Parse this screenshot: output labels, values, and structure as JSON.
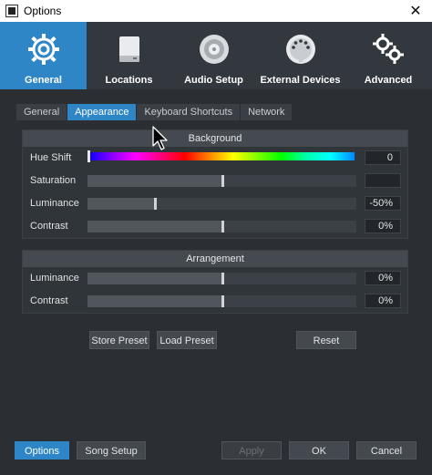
{
  "window": {
    "title": "Options",
    "close_glyph": "✕"
  },
  "topnav": [
    {
      "label": "General",
      "icon": "gear-icon",
      "active": true
    },
    {
      "label": "Locations",
      "icon": "drive-icon",
      "active": false
    },
    {
      "label": "Audio Setup",
      "icon": "speaker-icon",
      "active": false
    },
    {
      "label": "External Devices",
      "icon": "midi-port-icon",
      "active": false
    },
    {
      "label": "Advanced",
      "icon": "gears-icon",
      "active": false
    }
  ],
  "subtabs": [
    "General",
    "Appearance",
    "Keyboard Shortcuts",
    "Network"
  ],
  "background": {
    "header": "Background",
    "hue_shift": {
      "label": "Hue Shift",
      "value": "0"
    },
    "saturation": {
      "label": "Saturation",
      "value": "",
      "position": 0.5
    },
    "luminance": {
      "label": "Luminance",
      "value": "-50%",
      "position": 0.25
    },
    "contrast": {
      "label": "Contrast",
      "value": "0%",
      "position": 0.5
    }
  },
  "arrangement": {
    "header": "Arrangement",
    "luminance": {
      "label": "Luminance",
      "value": "0%",
      "position": 0.5
    },
    "contrast": {
      "label": "Contrast",
      "value": "0%",
      "position": 0.5
    }
  },
  "preset_buttons": {
    "store": "Store Preset",
    "load": "Load Preset",
    "reset": "Reset"
  },
  "footer": {
    "options": "Options",
    "song_setup": "Song Setup",
    "apply": "Apply",
    "ok": "OK",
    "cancel": "Cancel"
  },
  "colors": {
    "accent": "#2f86c6",
    "background": "#2b2f34",
    "nav": "#33383e"
  }
}
